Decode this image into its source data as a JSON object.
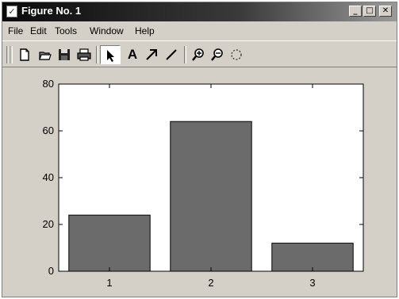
{
  "window": {
    "title": "Figure No. 1"
  },
  "title_buttons": {
    "minimize": "_",
    "maximize": "□",
    "close": "✕"
  },
  "menu": [
    "File",
    "Edit",
    "Tools",
    "Window",
    "Help"
  ],
  "toolbar": {
    "text_tool": "A",
    "icons": [
      "new-file-icon",
      "open-folder-icon",
      "save-icon",
      "print-icon",
      "select-arrow-icon",
      "text-icon",
      "arrow-icon",
      "line-icon",
      "zoom-in-icon",
      "zoom-out-icon",
      "rotate-icon"
    ]
  },
  "chart_data": {
    "type": "bar",
    "categories": [
      "1",
      "2",
      "3"
    ],
    "values": [
      24,
      64,
      12
    ],
    "ylim": [
      0,
      80
    ],
    "yticks": [
      "0",
      "20",
      "40",
      "60",
      "80"
    ],
    "title": "",
    "xlabel": "",
    "ylabel": "",
    "bar_color": "#6b6b6b",
    "background": "#ffffff",
    "grid": false
  }
}
